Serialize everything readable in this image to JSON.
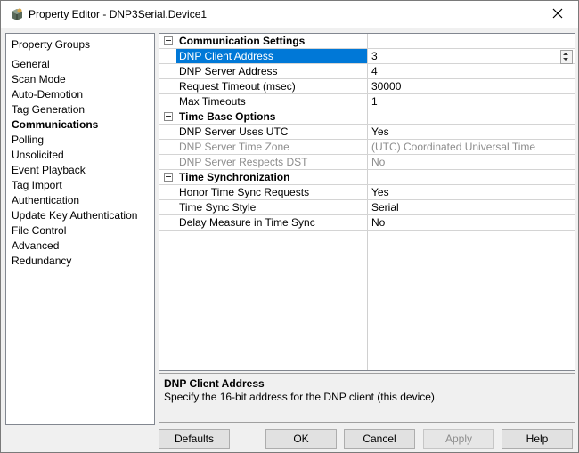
{
  "window": {
    "title": "Property Editor - DNP3Serial.Device1",
    "app_icon": "property-editor-icon",
    "close_icon": "close-icon"
  },
  "groups": {
    "header": "Property Groups",
    "items": [
      "General",
      "Scan Mode",
      "Auto-Demotion",
      "Tag Generation",
      "Communications",
      "Polling",
      "Unsolicited",
      "Event Playback",
      "Tag Import",
      "Authentication",
      "Update Key Authentication",
      "File Control",
      "Advanced",
      "Redundancy"
    ],
    "selected": "Communications"
  },
  "grid": {
    "cat1": "Communication Settings",
    "cat1_rows": [
      {
        "name": "DNP Client Address",
        "value": "3"
      },
      {
        "name": "DNP Server Address",
        "value": "4"
      },
      {
        "name": "Request Timeout (msec)",
        "value": "30000"
      },
      {
        "name": "Max Timeouts",
        "value": "1"
      }
    ],
    "cat2": "Time Base Options",
    "cat2_rows": [
      {
        "name": "DNP Server Uses UTC",
        "value": "Yes"
      },
      {
        "name": "DNP Server Time Zone",
        "value": "(UTC) Coordinated Universal Time"
      },
      {
        "name": "DNP Server Respects DST",
        "value": "No"
      }
    ],
    "cat3": "Time Synchronization",
    "cat3_rows": [
      {
        "name": "Honor Time Sync Requests",
        "value": "Yes"
      },
      {
        "name": "Time Sync Style",
        "value": "Serial"
      },
      {
        "name": "Delay Measure in Time Sync",
        "value": "No"
      }
    ]
  },
  "description": {
    "title": "DNP Client Address",
    "text": "Specify the 16-bit address for the DNP client (this device)."
  },
  "buttons": {
    "defaults": "Defaults",
    "ok": "OK",
    "cancel": "Cancel",
    "apply": "Apply",
    "help": "Help"
  },
  "colors": {
    "selection": "#0078d7",
    "disabled_text": "#8d8d8d"
  }
}
